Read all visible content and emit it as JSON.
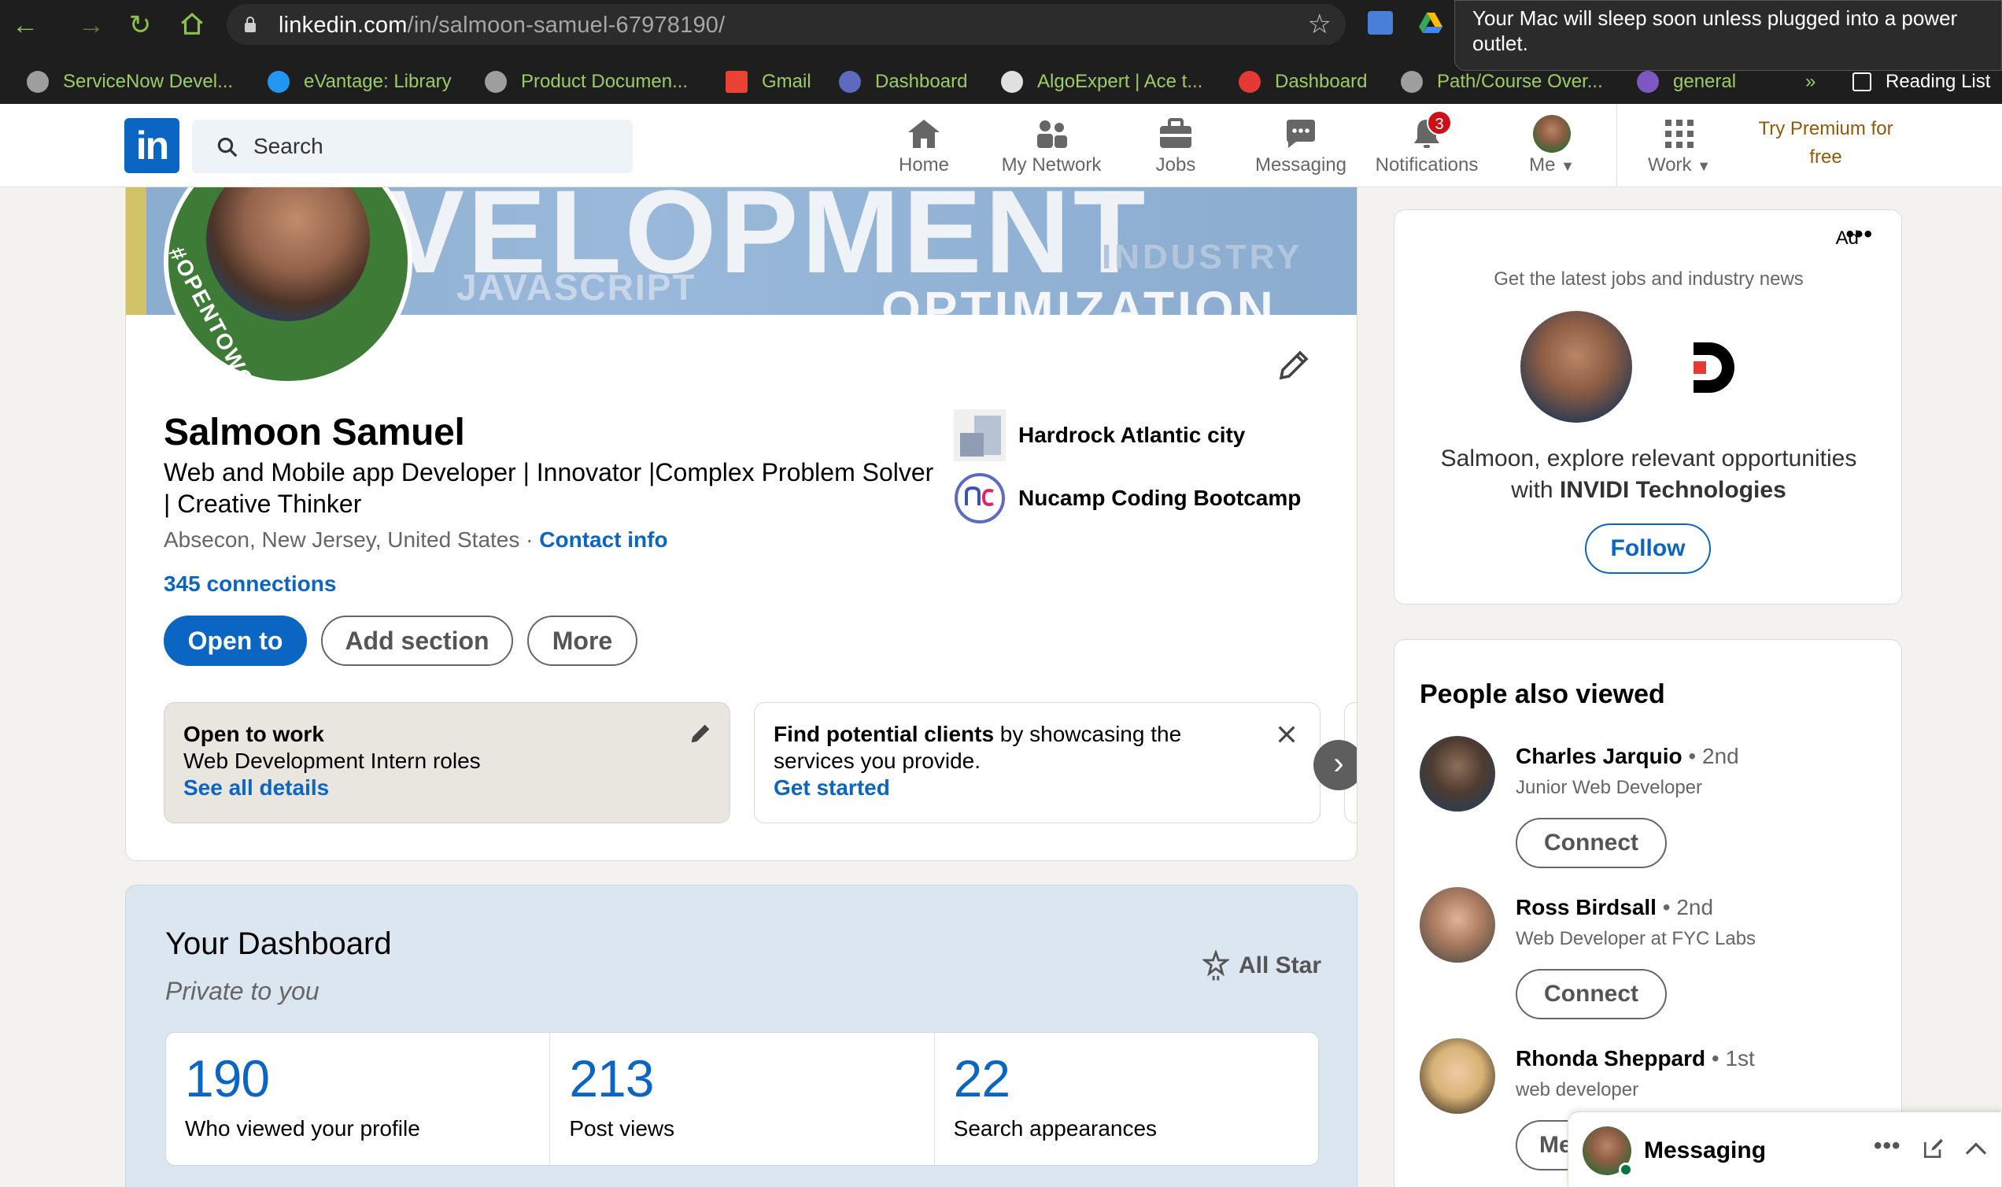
{
  "browser": {
    "url_domain": "linkedin.com",
    "url_path": "/in/salmoon-samuel-67978190/",
    "toast": "Your Mac will sleep soon unless plugged into a power outlet.",
    "bookmarks": [
      {
        "label": "ServiceNow Devel...",
        "color": "#9e9e9e"
      },
      {
        "label": "eVantage: Library",
        "color": "#2196f3"
      },
      {
        "label": "Product Documen...",
        "color": "#9e9e9e"
      },
      {
        "label": "Gmail",
        "color": "#ea4335"
      },
      {
        "label": "Dashboard",
        "color": "#5c6bc0"
      },
      {
        "label": "AlgoExpert | Ace t...",
        "color": "#e0e0e0"
      },
      {
        "label": "Dashboard",
        "color": "#e53935"
      },
      {
        "label": "Path/Course Over...",
        "color": "#9e9e9e"
      },
      {
        "label": "general",
        "color": "#7e57c2"
      }
    ],
    "overflow": "»",
    "reading_list": "Reading List"
  },
  "header": {
    "logo_text": "in",
    "search_placeholder": "Search",
    "nav": [
      {
        "label": "Home",
        "icon": "home-icon"
      },
      {
        "label": "My Network",
        "icon": "network-icon"
      },
      {
        "label": "Jobs",
        "icon": "jobs-icon"
      },
      {
        "label": "Messaging",
        "icon": "messaging-icon"
      },
      {
        "label": "Notifications",
        "icon": "bell-icon",
        "badge": "3"
      },
      {
        "label": "Me",
        "icon": "avatar-icon"
      },
      {
        "label": "Work",
        "icon": "grid-icon"
      }
    ],
    "premium_line1": "Try Premium for",
    "premium_line2": "free"
  },
  "banner": {
    "words": [
      "VELOPMENT",
      "JAVASCRIPT",
      "OPTIMIZATION",
      "INDUSTRY"
    ]
  },
  "avatar_frame_text": "#OPENTOWORK",
  "profile": {
    "name": "Salmoon Samuel",
    "headline": "Web and Mobile app Developer | Innovator |Complex Problem Solver | Creative Thinker",
    "location": "Absecon, New Jersey, United States",
    "separator": " · ",
    "contact_info": "Contact info",
    "connections": "345 connections",
    "buttons": {
      "open_to": "Open to",
      "add_section": "Add section",
      "more": "More"
    },
    "experience": [
      {
        "name": "Hardrock Atlantic city"
      },
      {
        "name": "Nucamp Coding Bootcamp"
      }
    ]
  },
  "open_to_work": {
    "title": "Open to work",
    "roles": "Web Development Intern roles",
    "link": "See all details"
  },
  "find_clients": {
    "bold": "Find potential clients",
    "rest": " by showcasing the",
    "line2": "services you provide.",
    "link": "Get started"
  },
  "dashboard": {
    "title": "Your Dashboard",
    "subtitle": "Private to you",
    "all_star": "All Star",
    "stats": [
      {
        "value": "190",
        "label": "Who viewed your profile"
      },
      {
        "value": "213",
        "label": "Post views"
      },
      {
        "value": "22",
        "label": "Search appearances"
      }
    ]
  },
  "ad": {
    "label": "Ad",
    "menu": "•••",
    "tagline": "Get the latest jobs and industry news",
    "pitch_prefix": "Salmoon, explore relevant opportunities with ",
    "company": "INVIDI Technologies",
    "follow": "Follow"
  },
  "people_also_viewed": {
    "title": "People also viewed",
    "people": [
      {
        "name": "Charles Jarquio",
        "degree": " • 2nd",
        "title": "Junior Web Developer",
        "action": "Connect",
        "color": "#2c3e50"
      },
      {
        "name": "Ross Birdsall",
        "degree": " • 2nd",
        "title": "Web Developer at FYC Labs",
        "action": "Connect",
        "color": "#a1887f"
      },
      {
        "name": "Rhonda Sheppard",
        "degree": " • 1st",
        "title": "web developer",
        "action": "Me",
        "color": "#d7b377"
      }
    ]
  },
  "messaging": {
    "label": "Messaging",
    "more": "•••"
  }
}
